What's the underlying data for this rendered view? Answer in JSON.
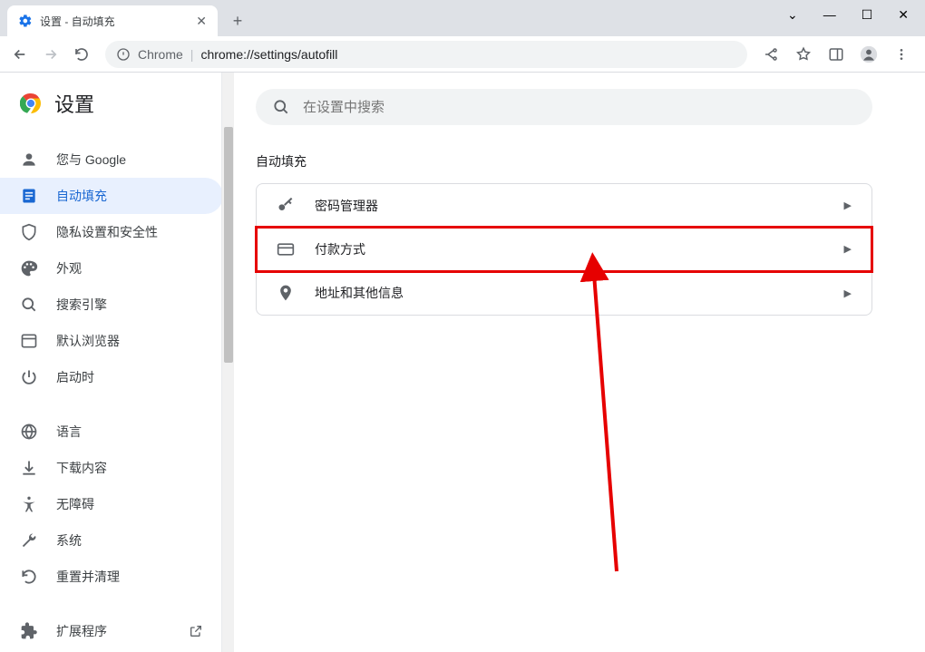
{
  "window": {
    "tab_title": "设置 - 自动填充"
  },
  "toolbar": {
    "url_host": "Chrome",
    "url_path": "chrome://settings/autofill"
  },
  "sidebar": {
    "title": "设置",
    "items": [
      {
        "label": "您与 Google"
      },
      {
        "label": "自动填充"
      },
      {
        "label": "隐私设置和安全性"
      },
      {
        "label": "外观"
      },
      {
        "label": "搜索引擎"
      },
      {
        "label": "默认浏览器"
      },
      {
        "label": "启动时"
      },
      {
        "label": "语言"
      },
      {
        "label": "下载内容"
      },
      {
        "label": "无障碍"
      },
      {
        "label": "系统"
      },
      {
        "label": "重置并清理"
      },
      {
        "label": "扩展程序"
      }
    ]
  },
  "main": {
    "search_placeholder": "在设置中搜索",
    "section_title": "自动填充",
    "rows": [
      {
        "label": "密码管理器"
      },
      {
        "label": "付款方式"
      },
      {
        "label": "地址和其他信息"
      }
    ]
  }
}
